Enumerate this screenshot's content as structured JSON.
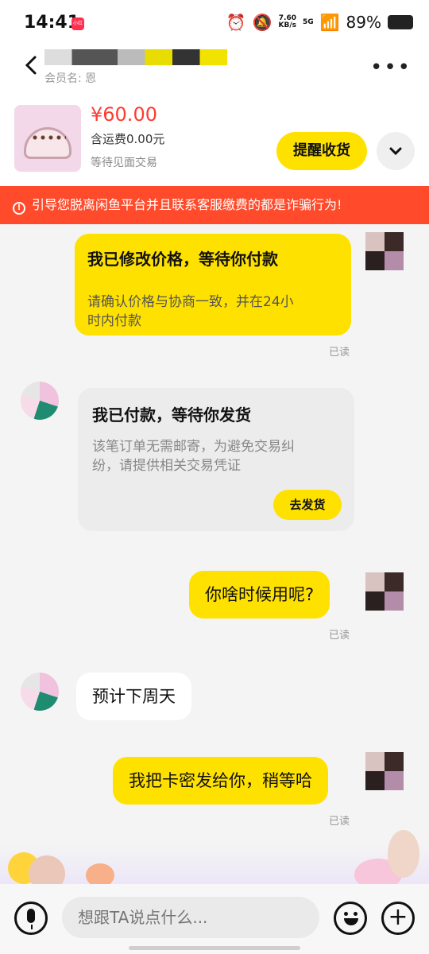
{
  "status_bar": {
    "time": "14:41",
    "app_badge": "小红书",
    "net_speed": "7.60",
    "net_unit": "KB/s",
    "network": "5G",
    "battery": "89%"
  },
  "header": {
    "member_label": "会员名: 恩"
  },
  "product": {
    "price": "¥60.00",
    "shipping": "含运费0.00元",
    "deal_type": "等待见面交易",
    "remind_button": "提醒收货"
  },
  "warning": {
    "text": "引导您脱离闲鱼平台并且联系客服缴费的都是诈骗行为!"
  },
  "messages": [
    {
      "title": "我已修改价格，等待你付款",
      "body_line1": "请确认价格与协商一致，并在24小",
      "body_line2": "时内付款",
      "read": "已读"
    },
    {
      "title": "我已付款，等待你发货",
      "body_line1": "该笔订单无需邮寄，为避免交易纠",
      "body_line2": "纷，请提供相关交易凭证",
      "button": "去发货"
    },
    {
      "text": "你啥时候用呢?",
      "read": "已读"
    },
    {
      "text": "预计下周天"
    },
    {
      "text": "我把卡密发给你，稍等哈",
      "read": "已读"
    }
  ],
  "input": {
    "placeholder": "想跟TA说点什么..."
  },
  "colors": {
    "accent": "#ffe100",
    "warning": "#ff4b2b",
    "price": "#ff3b30"
  }
}
